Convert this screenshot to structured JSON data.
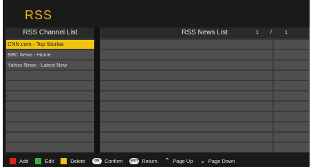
{
  "header": {
    "title": "RSS"
  },
  "channels": {
    "header": "RSS Channel List",
    "items": [
      "CNN.com - Top Stories",
      "BBC News - Home",
      "Yahoo News - Latest New"
    ],
    "selected_index": 0
  },
  "news": {
    "header": "RSS News List",
    "page_current": "1",
    "page_separator": "/",
    "page_total": "1"
  },
  "footer": {
    "red_label": "Add",
    "green_label": "Edit",
    "yellow_label": "Delete",
    "ok_key": "OK",
    "ok_label": "Confirm",
    "exit_key": "EXIT",
    "exit_label": "Return",
    "up_label": "Page Up",
    "down_label": "Page Down",
    "colors": {
      "red": "#e0201c",
      "green": "#2db83d",
      "yellow": "#f2c40f"
    }
  },
  "colors": {
    "accent": "#f2b21a",
    "selection": "#f2c40f"
  }
}
